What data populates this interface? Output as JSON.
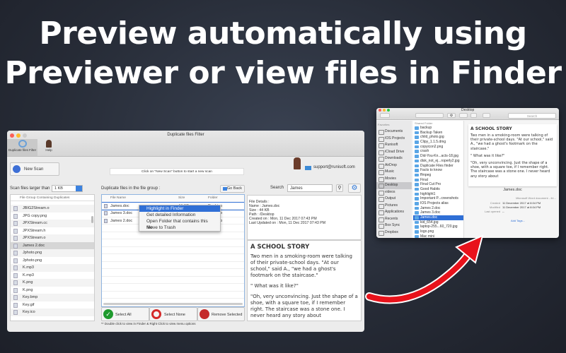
{
  "headline": [
    "Preview automatically using",
    "Previewer or view files in Finder"
  ],
  "app": {
    "title": "Duplicate files Filter",
    "toolbar": [
      {
        "label": "Duplicate files Filter"
      },
      {
        "label": "Help"
      }
    ],
    "new_scan": "New Scan",
    "hint": "Click on \"New Scan\" button to start a new scan",
    "support_email": "support@runisoft.com",
    "scan_label": "Scan files larger than",
    "scan_value": "1 KB",
    "left_header": "File Group Containing Duplicates",
    "left_items": [
      "JBIG2Stream.o",
      "JPG copy.png",
      "JPXStream.cc",
      "JPXStream.h",
      "JPXStream.o",
      "James 2.doc",
      "Jphoto.png",
      "Jphoto.png",
      "K.mp3",
      "K.mp3",
      "K.png",
      "K.png",
      "Key.bmp",
      "Key.gif",
      "Key.ico"
    ],
    "group_label": "Duplicate files in the file group :",
    "go_back": "Go Back",
    "columns": [
      "File Name",
      "Size",
      "Folder"
    ],
    "files": [
      {
        "name": "James.doc",
        "size": "44 KB",
        "folder": "Desktop"
      },
      {
        "name": "James 3.doc",
        "size": "",
        "folder": "Desktop"
      },
      {
        "name": "James 2.doc",
        "size": "",
        "folder": "Desktop"
      }
    ],
    "context_menu": [
      "Highlight in Finder",
      "Get detailed Information",
      "Open Folder that contains this file",
      "Move to Trash"
    ],
    "search_label": "Search",
    "search_value": "James",
    "details": [
      "File Details :",
      "Name : James.doc",
      "Size : 44 KB",
      "Path : /Desktop",
      "Created on : Mon, 11 Dec 2017 07:43 PM",
      "Last Updated on : Mon, 11 Dec 2017 07:43 PM"
    ],
    "preview_title": "A SCHOOL STORY",
    "preview_text": [
      "Two men in a smoking-room were talking of their private-school days. \"At our school,\" said A., \"we had a ghost's footmark on the staircase.\"",
      "\" What was it like?\"",
      "\"Oh, very unconvincing. Just the shape of a shoe, with a square toe, if I remember right. The staircase was a stone one. I never heard any story about"
    ],
    "select_all": "Select All",
    "select_none": "Select None",
    "remove_selected": "Remove Selected",
    "footnote": "** Double click to view in Finder & Right Click  to view menu options"
  },
  "finder": {
    "title": "Desktop",
    "search_placeholder": "Search",
    "favorites_label": "Favorites",
    "sidebar": [
      "Documents",
      "IOS Projects",
      "Runisoft",
      "iCloud Drive",
      "Downloads",
      "AirDrop",
      "Music",
      "Movies",
      "Desktop",
      "videos",
      "Output",
      "Pictures",
      "Applications",
      "Recents",
      "Box Sync",
      "Dropbox"
    ],
    "column_header": "Shared Folder",
    "files": [
      "backup",
      "Backup Taken",
      "child_photo.jpg",
      "Clipy_1.1.5.dmg",
      "copyicon2.png",
      "crash",
      "Did-You-Kn...acts-18.jpg",
      "disk_not_ej...roperly2.jpg",
      "Duplicate Files finder",
      "Facts to know",
      "ffmpeg",
      "Final",
      "Final Cut Pro",
      "Good Habits",
      "highlight1",
      "Important P...creenshots",
      "IOS Projects alias",
      "James 2.doc",
      "James 3.doc",
      "James.doc",
      "kid_654.jpg",
      "laptop-255...60_720.jpg",
      "logo.png",
      "Mac mini"
    ],
    "preview_title": "A SCHOOL STORY",
    "preview_text": [
      "Two men in a smoking-room were talking of their private-school days. \"At our school,\" said A., \"we had a ghost's footmark on the staircase.\"",
      "\" What was it like?\"",
      "\"Oh, very unconvincing. Just the shape of a shoe, with a square toe, if I remember right. The staircase was a stone one. I never heard any story about"
    ],
    "file_name": "James.doc",
    "kind": "Microsoft Word document - 44...",
    "meta": [
      {
        "k": "Created",
        "v": "11 December 2017 at 8:04 PM"
      },
      {
        "k": "Modified",
        "v": "11 December 2017 at 8:04 PM"
      },
      {
        "k": "Last opened",
        "v": "--"
      }
    ],
    "add_tags": "Add Tags..."
  },
  "colors": {
    "accent": "#2f6fd6",
    "arrow": "#e8121b",
    "background": "#262b36"
  }
}
